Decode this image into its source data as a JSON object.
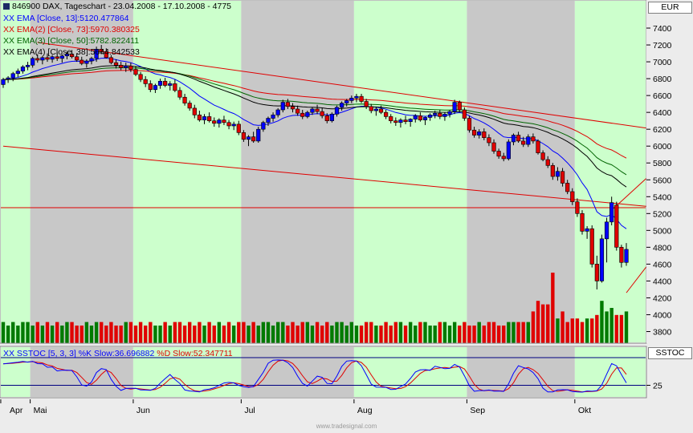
{
  "header": {
    "title": "846900 DAX, Tageschart - 23.04.2008 - 17.10.2008 - 4775",
    "currency": "EUR",
    "stoch_axis_label": "SSTOC"
  },
  "legend": [
    {
      "text": "XX EMA [Close, 13]:5120.477864",
      "color": "#0000ff"
    },
    {
      "text": "XX EMA(2) [Close, 73]:5970.380325",
      "color": "#e00000"
    },
    {
      "text": "XX EMA(3) [Close, 50]:5782.822411",
      "color": "#006400"
    },
    {
      "text": "XX EMA(4) [Close, 38]:5644.842533",
      "color": "#000000"
    }
  ],
  "stoch_legend": {
    "k_text": "XX SSTOC [5, 3, 3] %K Slow:36.696882",
    "d_text": "%D Slow:52.347711",
    "k_color": "#0000ff",
    "d_color": "#e00000"
  },
  "footer": "www.tradesignal.com",
  "colors": {
    "band_green": "#ccffcc",
    "band_gray": "#c8c8c8",
    "up": "#0000ff",
    "down": "#e00000",
    "vol_up": "#007a00",
    "vol_down": "#e00000",
    "trend": "#e00000"
  },
  "chart_data": {
    "type": "candlestick",
    "title": "846900 DAX, Tageschart - 23.04.2008 - 17.10.2008 - 4775",
    "ylabel": "EUR",
    "ylim": [
      3700,
      7600
    ],
    "yticks": [
      3800,
      4000,
      4200,
      4400,
      4600,
      4800,
      5000,
      5200,
      5400,
      5600,
      5800,
      6000,
      6200,
      6400,
      6600,
      6800,
      7000,
      7200,
      7400
    ],
    "months": [
      "Apr",
      "Mai",
      "Jun",
      "Jul",
      "Aug",
      "Sep",
      "Okt"
    ],
    "month_start_index": [
      0,
      6,
      27,
      49,
      72,
      95,
      117
    ],
    "ohlc": [
      [
        6730,
        6810,
        6690,
        6790
      ],
      [
        6795,
        6830,
        6750,
        6810
      ],
      [
        6810,
        6880,
        6770,
        6860
      ],
      [
        6860,
        6920,
        6820,
        6890
      ],
      [
        6890,
        6960,
        6860,
        6940
      ],
      [
        6940,
        7000,
        6900,
        6960
      ],
      [
        6960,
        7060,
        6930,
        7040
      ],
      [
        7040,
        7090,
        6990,
        7020
      ],
      [
        7020,
        7070,
        6970,
        7050
      ],
      [
        7050,
        7100,
        7000,
        7030
      ],
      [
        7030,
        7080,
        6990,
        7060
      ],
      [
        7060,
        7110,
        7010,
        7040
      ],
      [
        7040,
        7090,
        6990,
        7070
      ],
      [
        7070,
        7120,
        7030,
        7090
      ],
      [
        7090,
        7140,
        7040,
        7060
      ],
      [
        7060,
        7100,
        7000,
        7020
      ],
      [
        7020,
        7060,
        6960,
        6980
      ],
      [
        6980,
        7030,
        6930,
        7010
      ],
      [
        7010,
        7060,
        6970,
        7040
      ],
      [
        7040,
        7180,
        7000,
        7150
      ],
      [
        7150,
        7200,
        7090,
        7120
      ],
      [
        7120,
        7160,
        7040,
        7050
      ],
      [
        7050,
        7080,
        6970,
        6990
      ],
      [
        6990,
        7030,
        6920,
        6960
      ],
      [
        6960,
        7000,
        6900,
        6930
      ],
      [
        6930,
        6990,
        6880,
        6950
      ],
      [
        6950,
        6990,
        6880,
        6910
      ],
      [
        6910,
        6950,
        6830,
        6850
      ],
      [
        6850,
        6880,
        6760,
        6790
      ],
      [
        6790,
        6830,
        6700,
        6740
      ],
      [
        6740,
        6780,
        6640,
        6670
      ],
      [
        6670,
        6740,
        6630,
        6720
      ],
      [
        6720,
        6800,
        6680,
        6770
      ],
      [
        6770,
        6810,
        6700,
        6720
      ],
      [
        6720,
        6770,
        6660,
        6740
      ],
      [
        6740,
        6790,
        6640,
        6660
      ],
      [
        6660,
        6700,
        6550,
        6580
      ],
      [
        6580,
        6620,
        6480,
        6510
      ],
      [
        6510,
        6540,
        6420,
        6450
      ],
      [
        6450,
        6490,
        6330,
        6370
      ],
      [
        6370,
        6420,
        6290,
        6310
      ],
      [
        6310,
        6380,
        6260,
        6350
      ],
      [
        6350,
        6400,
        6280,
        6300
      ],
      [
        6300,
        6340,
        6230,
        6270
      ],
      [
        6270,
        6330,
        6220,
        6310
      ],
      [
        6310,
        6360,
        6250,
        6280
      ],
      [
        6280,
        6310,
        6200,
        6240
      ],
      [
        6240,
        6290,
        6190,
        6260
      ],
      [
        6260,
        6300,
        6130,
        6160
      ],
      [
        6160,
        6190,
        6050,
        6080
      ],
      [
        6080,
        6130,
        6000,
        6110
      ],
      [
        6110,
        6170,
        6040,
        6060
      ],
      [
        6060,
        6230,
        6040,
        6200
      ],
      [
        6200,
        6300,
        6170,
        6280
      ],
      [
        6280,
        6350,
        6240,
        6330
      ],
      [
        6330,
        6400,
        6290,
        6370
      ],
      [
        6370,
        6450,
        6340,
        6430
      ],
      [
        6430,
        6550,
        6400,
        6520
      ],
      [
        6520,
        6560,
        6440,
        6470
      ],
      [
        6470,
        6510,
        6400,
        6440
      ],
      [
        6440,
        6480,
        6360,
        6390
      ],
      [
        6390,
        6430,
        6320,
        6350
      ],
      [
        6350,
        6420,
        6330,
        6400
      ],
      [
        6400,
        6460,
        6370,
        6440
      ],
      [
        6440,
        6490,
        6380,
        6410
      ],
      [
        6410,
        6450,
        6330,
        6360
      ],
      [
        6360,
        6390,
        6270,
        6300
      ],
      [
        6300,
        6400,
        6280,
        6380
      ],
      [
        6380,
        6480,
        6350,
        6460
      ],
      [
        6460,
        6530,
        6420,
        6510
      ],
      [
        6510,
        6560,
        6470,
        6540
      ],
      [
        6540,
        6600,
        6510,
        6570
      ],
      [
        6570,
        6620,
        6520,
        6590
      ],
      [
        6590,
        6620,
        6510,
        6530
      ],
      [
        6530,
        6560,
        6440,
        6470
      ],
      [
        6470,
        6500,
        6390,
        6420
      ],
      [
        6420,
        6460,
        6360,
        6440
      ],
      [
        6440,
        6480,
        6380,
        6400
      ],
      [
        6400,
        6430,
        6320,
        6350
      ],
      [
        6350,
        6380,
        6270,
        6300
      ],
      [
        6300,
        6340,
        6240,
        6280
      ],
      [
        6280,
        6330,
        6220,
        6310
      ],
      [
        6310,
        6360,
        6260,
        6290
      ],
      [
        6290,
        6330,
        6230,
        6320
      ],
      [
        6320,
        6380,
        6280,
        6360
      ],
      [
        6360,
        6400,
        6290,
        6310
      ],
      [
        6310,
        6350,
        6250,
        6340
      ],
      [
        6340,
        6390,
        6300,
        6370
      ],
      [
        6370,
        6420,
        6330,
        6390
      ],
      [
        6390,
        6430,
        6320,
        6350
      ],
      [
        6350,
        6400,
        6300,
        6380
      ],
      [
        6380,
        6430,
        6340,
        6410
      ],
      [
        6410,
        6550,
        6380,
        6520
      ],
      [
        6520,
        6540,
        6400,
        6430
      ],
      [
        6430,
        6460,
        6300,
        6330
      ],
      [
        6330,
        6360,
        6160,
        6190
      ],
      [
        6190,
        6230,
        6100,
        6130
      ],
      [
        6130,
        6200,
        6090,
        6170
      ],
      [
        6170,
        6210,
        6070,
        6100
      ],
      [
        6100,
        6140,
        6000,
        6040
      ],
      [
        6040,
        6080,
        5910,
        5940
      ],
      [
        5940,
        5970,
        5850,
        5880
      ],
      [
        5880,
        5920,
        5820,
        5850
      ],
      [
        5850,
        6080,
        5830,
        6050
      ],
      [
        6050,
        6150,
        6010,
        6130
      ],
      [
        6130,
        6170,
        6040,
        6060
      ],
      [
        6060,
        6110,
        5990,
        6020
      ],
      [
        6020,
        6140,
        5990,
        6110
      ],
      [
        6110,
        6150,
        6030,
        6060
      ],
      [
        6060,
        6080,
        5900,
        5920
      ],
      [
        5920,
        5950,
        5820,
        5840
      ],
      [
        5840,
        5880,
        5740,
        5770
      ],
      [
        5770,
        5800,
        5600,
        5640
      ],
      [
        5640,
        5750,
        5590,
        5700
      ],
      [
        5700,
        5740,
        5520,
        5560
      ],
      [
        5560,
        5600,
        5430,
        5460
      ],
      [
        5460,
        5500,
        5300,
        5340
      ],
      [
        5340,
        5380,
        5160,
        5200
      ],
      [
        5200,
        5240,
        4950,
        4990
      ],
      [
        4990,
        5050,
        4900,
        5020
      ],
      [
        5020,
        5060,
        4560,
        4600
      ],
      [
        4600,
        4700,
        4300,
        4400
      ],
      [
        4400,
        4950,
        4380,
        4900
      ],
      [
        4900,
        5150,
        4620,
        5100
      ],
      [
        5100,
        5400,
        5060,
        5330
      ],
      [
        5300,
        5340,
        4760,
        4800
      ],
      [
        4800,
        4830,
        4560,
        4620
      ],
      [
        4620,
        4850,
        4580,
        4775
      ]
    ],
    "volume": [
      6,
      5,
      6,
      5,
      6,
      6,
      5,
      6,
      5,
      6,
      5,
      6,
      5,
      6,
      6,
      5,
      5,
      6,
      5,
      6,
      6,
      5,
      6,
      5,
      5,
      6,
      6,
      5,
      6,
      5,
      6,
      5,
      5,
      6,
      5,
      6,
      6,
      5,
      6,
      5,
      6,
      5,
      6,
      5,
      6,
      5,
      6,
      5,
      6,
      6,
      5,
      6,
      5,
      6,
      6,
      5,
      6,
      6,
      5,
      6,
      5,
      6,
      6,
      5,
      6,
      5,
      6,
      5,
      6,
      6,
      5,
      6,
      5,
      5,
      6,
      6,
      5,
      5,
      6,
      5,
      6,
      6,
      5,
      6,
      5,
      6,
      6,
      5,
      5,
      6,
      6,
      5,
      6,
      5,
      6,
      5,
      5,
      6,
      5,
      6,
      6,
      5,
      5,
      6,
      6,
      6,
      6,
      6,
      9,
      12,
      11,
      11,
      20,
      7,
      9,
      6,
      7,
      7,
      6,
      7,
      7,
      8,
      12,
      9,
      10,
      8,
      8,
      9
    ],
    "ema13_last": 5120.477864,
    "ema73_last": 5970.380325,
    "ema50_last": 5782.822411,
    "ema38_last": 5644.842533,
    "stoch_ylim": [
      0,
      100
    ],
    "stoch_ticks": [
      25
    ],
    "stoch_k_last": 36.696882,
    "stoch_d_last": 52.347711,
    "horizontal_line": 5270,
    "trendlines": [
      {
        "from": [
          7,
          7230
        ],
        "to": [
          134,
          6190
        ]
      },
      {
        "from": [
          0,
          6000
        ],
        "to": [
          134,
          5270
        ]
      },
      {
        "from": [
          127,
          4260
        ],
        "to": [
          134,
          4790
        ]
      },
      {
        "from": [
          124,
          5240
        ],
        "to": [
          133,
          5720
        ]
      }
    ]
  }
}
